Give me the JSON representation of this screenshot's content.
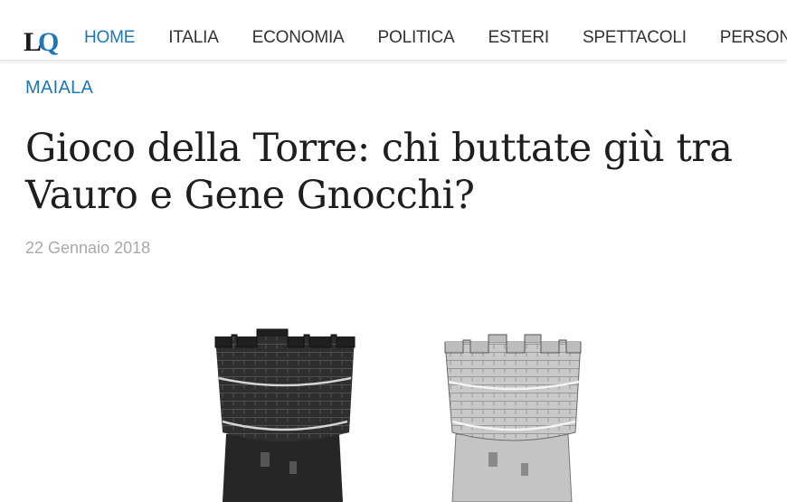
{
  "header": {
    "logo": {
      "part1": "L",
      "part2": "Q"
    },
    "nav": [
      "HOME",
      "ITALIA",
      "ECONOMIA",
      "POLITICA",
      "ESTERI",
      "SPETTACOLI",
      "PERSONAGGI"
    ],
    "active_index": 0
  },
  "article": {
    "category": "MAIALA",
    "title": "Gioco della Torre: chi buttate giù tra Vauro e Gene Gnocchi?",
    "date": "22 Gennaio 2018"
  },
  "image": {
    "towers": [
      "dark-tower",
      "light-tower"
    ]
  },
  "colors": {
    "accent": "#1f77b8",
    "text": "#1e1e1e",
    "muted": "#a9a9a9"
  }
}
